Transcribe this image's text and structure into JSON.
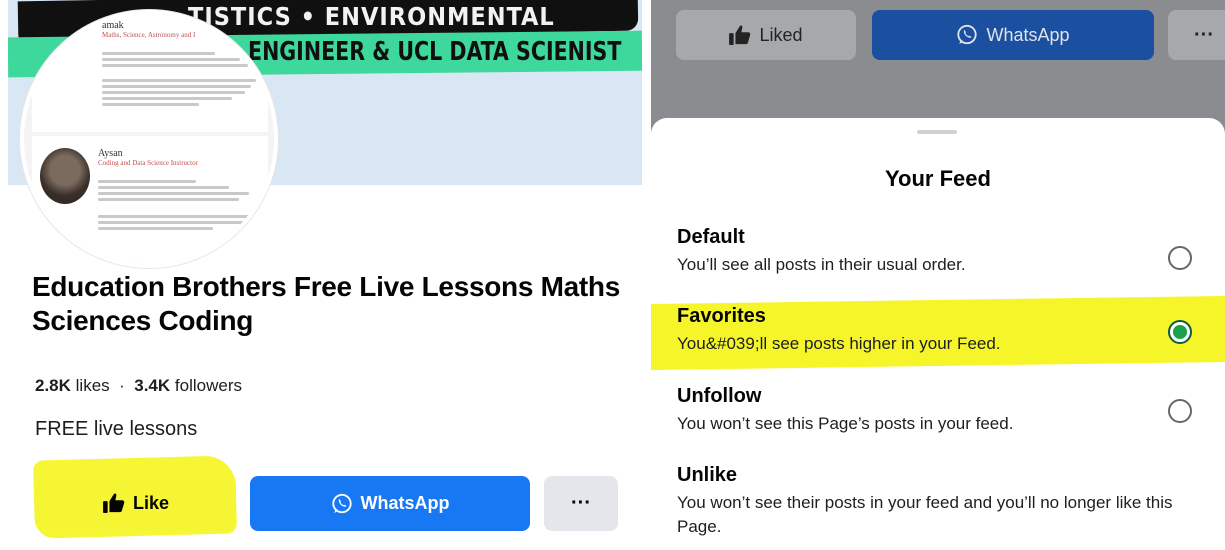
{
  "left": {
    "cover": {
      "banner_top": "TISTICS • ENVIRONMENTAL",
      "banner_green": "ENGINEER & UCL DATA SCIENIST",
      "card1_name": "amak",
      "card1_sub": "Maths, Science, Astronomy and I",
      "card2_name": "Aysan",
      "card2_sub": "Coding and Data Science Instructor"
    },
    "page_title": "Education Brothers Free Live Lessons Maths Sciences  Coding",
    "stats": {
      "likes_value": "2.8K",
      "likes_label": "likes",
      "sep": "·",
      "followers_value": "3.4K",
      "followers_label": "followers"
    },
    "bio": "FREE live lessons",
    "buttons": {
      "like": "Like",
      "whatsapp": "WhatsApp",
      "more": "···"
    }
  },
  "right": {
    "buttons": {
      "liked": "Liked",
      "whatsapp": "WhatsApp",
      "more": "···"
    },
    "sheet": {
      "title": "Your Feed",
      "options": [
        {
          "title": "Default",
          "desc": "You’ll see all posts in their usual order.",
          "selected": false
        },
        {
          "title": "Favorites",
          "desc": "You&#039;ll see posts higher in your Feed.",
          "selected": true
        },
        {
          "title": "Unfollow",
          "desc": "You won’t see this Page’s posts in your feed.",
          "selected": false
        },
        {
          "title": "Unlike",
          "desc": "You won’t see their posts in your feed and you’ll no longer like this Page.",
          "selected": false
        }
      ]
    }
  },
  "colors": {
    "primary_blue": "#1877f2",
    "highlight_yellow": "#f6f52a",
    "radio_selected": "#16a34a"
  },
  "icons": [
    "thumbs-up-icon",
    "whatsapp-icon",
    "more-icon"
  ]
}
